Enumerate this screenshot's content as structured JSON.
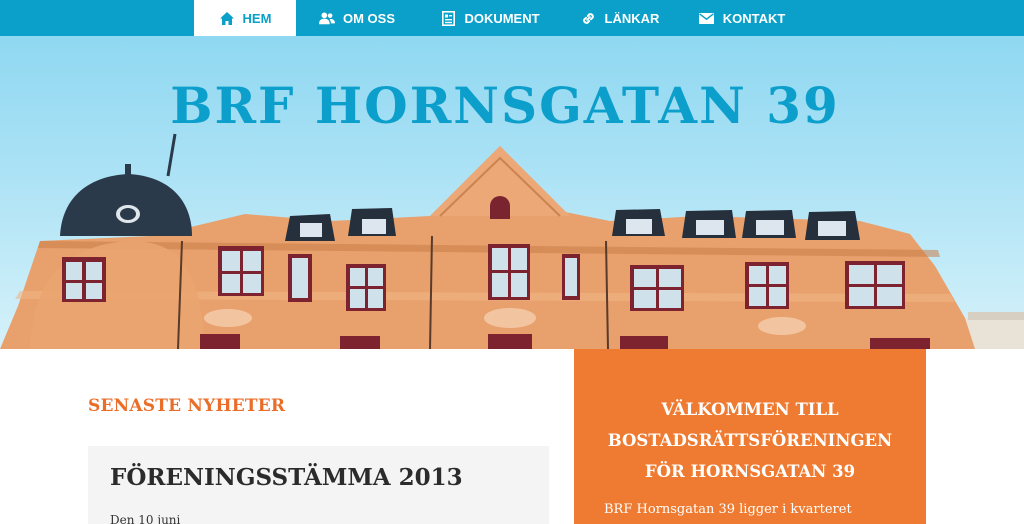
{
  "nav": {
    "items": [
      {
        "label": "HEM",
        "icon": "home-icon",
        "active": true
      },
      {
        "label": "OM OSS",
        "icon": "users-icon",
        "active": false
      },
      {
        "label": "DOKUMENT",
        "icon": "document-icon",
        "active": false
      },
      {
        "label": "LÄNKAR",
        "icon": "link-icon",
        "active": false
      },
      {
        "label": "KONTAKT",
        "icon": "envelope-icon",
        "active": false
      }
    ]
  },
  "hero": {
    "title": "BRF HORNSGATAN 39"
  },
  "news": {
    "heading": "SENASTE NYHETER",
    "posts": [
      {
        "title": "FÖRENINGSSTÄMMA 2013",
        "date": "Den 10 juni"
      }
    ]
  },
  "welcome": {
    "title_lines": [
      "VÄLKOMMEN TILL",
      "BOSTADSRÄTTSFÖRENINGEN",
      "FÖR HORNSGATAN 39"
    ],
    "text": "BRF Hornsgatan 39 ligger i kvarteret"
  },
  "colors": {
    "nav_bg": "#0aa0c9",
    "accent_orange": "#ea6d28",
    "sidebar_bg": "#ee7b31",
    "title_blue": "#0d9fcb"
  }
}
